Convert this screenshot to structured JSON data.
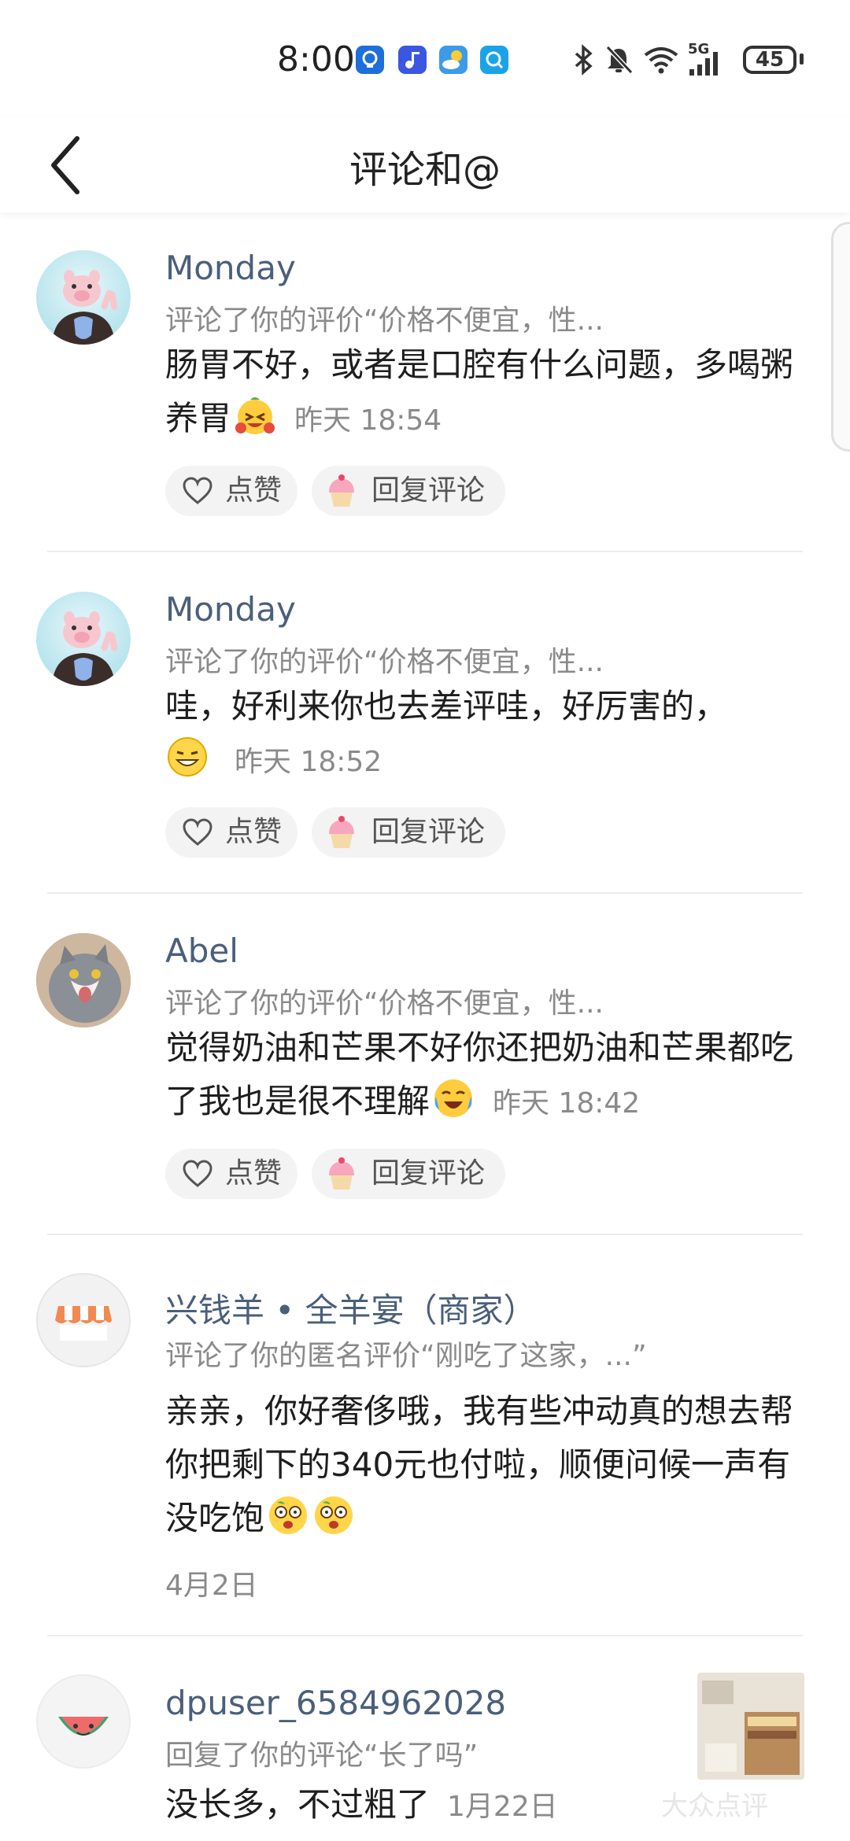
{
  "status_bar": {
    "time": "8:00",
    "battery": "45",
    "network": "5G",
    "icons": [
      "app-notify-icon",
      "music-icon",
      "weather-icon",
      "search-app-icon",
      "bluetooth-icon",
      "mute-icon",
      "wifi-icon",
      "signal-icon",
      "battery-icon"
    ]
  },
  "header": {
    "title": "评论和@",
    "back_icon": "chevron-left-icon"
  },
  "items": [
    {
      "author": "Monday",
      "context": "评论了你的评价“价格不便宜，性...",
      "text": "肠胃不好，或者是口腔有什么问题，多喝粥养胃",
      "emoji": "laughing-emoji",
      "time": "昨天 18:54",
      "like_label": "点赞",
      "reply_label": "回复评论"
    },
    {
      "author": "Monday",
      "context": "评论了你的评价“价格不便宜，性...",
      "text": "哇，好利来你也去差评哇，好厉害的，",
      "emoji": "grin-emoji",
      "time": "昨天 18:52",
      "like_label": "点赞",
      "reply_label": "回复评论"
    },
    {
      "author": "Abel",
      "context": "评论了你的评价“价格不便宜，性...",
      "text": "觉得奶油和芒果不好你还把奶油和芒果都吃了我也是很不理解",
      "emoji": "crying-laugh-emoji",
      "time": "昨天 18:42",
      "like_label": "点赞",
      "reply_label": "回复评论"
    },
    {
      "author": "兴钱羊 • 全羊宴（商家）",
      "context": "评论了你的匿名评价“刚吃了这家，...”",
      "text": "亲亲，你好奢侈哦，我有些冲动真的想去帮你把剩下的340元也付啦，顺便问候一声有没吃饱",
      "emoji": "shocked-emoji",
      "date": "4月2日"
    },
    {
      "author": "dpuser_6584962028",
      "context": "回复了你的评论“长了吗”",
      "text": "没长多，不过粗了",
      "time": "1月22日"
    }
  ],
  "watermark": "大众点评"
}
